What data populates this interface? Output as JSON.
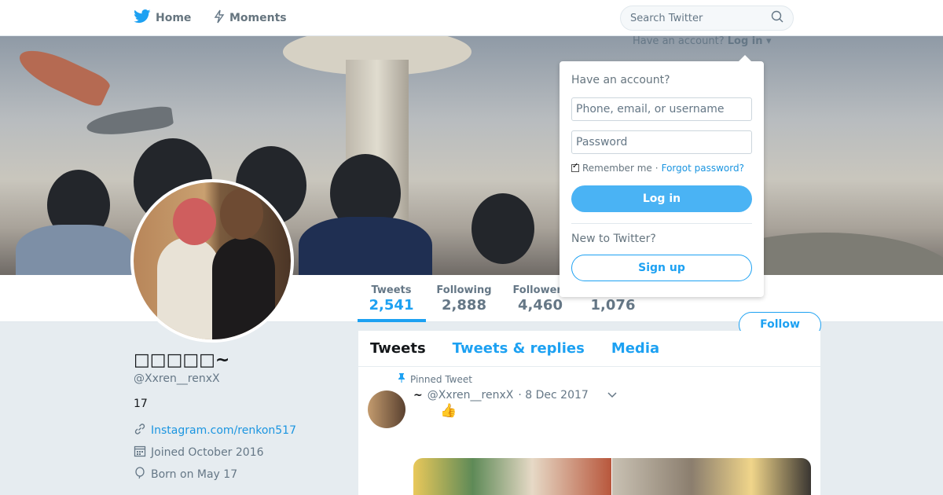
{
  "nav": {
    "home_label": "Home",
    "moments_label": "Moments",
    "search_placeholder": "Search Twitter"
  },
  "login_prompt": {
    "text": "Have an account?",
    "link": "Log in"
  },
  "login_dropdown": {
    "title": "Have an account?",
    "username_placeholder": "Phone, email, or username",
    "password_placeholder": "Password",
    "remember_label": "Remember me",
    "separator": "·",
    "forgot_link": "Forgot password?",
    "login_button": "Log in",
    "new_label": "New to Twitter?",
    "signup_button": "Sign up"
  },
  "stats": [
    {
      "label": "Tweets",
      "value": "2,541"
    },
    {
      "label": "Following",
      "value": "2,888"
    },
    {
      "label": "Followers",
      "value": "4,460"
    },
    {
      "label": "",
      "value": "1,076"
    }
  ],
  "follow_button": "Follow",
  "profile": {
    "name": "□□□□□~",
    "handle": "@Xxren__renxX",
    "bio": "17",
    "link": "Instagram.com/renkon517",
    "joined": "Joined October 2016",
    "born": "Born on May 17"
  },
  "timeline": {
    "tabs": [
      "Tweets",
      "Tweets & replies",
      "Media"
    ],
    "pinned_label": "Pinned Tweet",
    "tweet": {
      "name": "~",
      "handle": "@Xxren__renxX",
      "date": "· 8 Dec 2017",
      "text": "👍"
    }
  },
  "colors": {
    "accent": "#1da1f2",
    "background": "#e6ecf0",
    "muted_text": "#657786"
  }
}
